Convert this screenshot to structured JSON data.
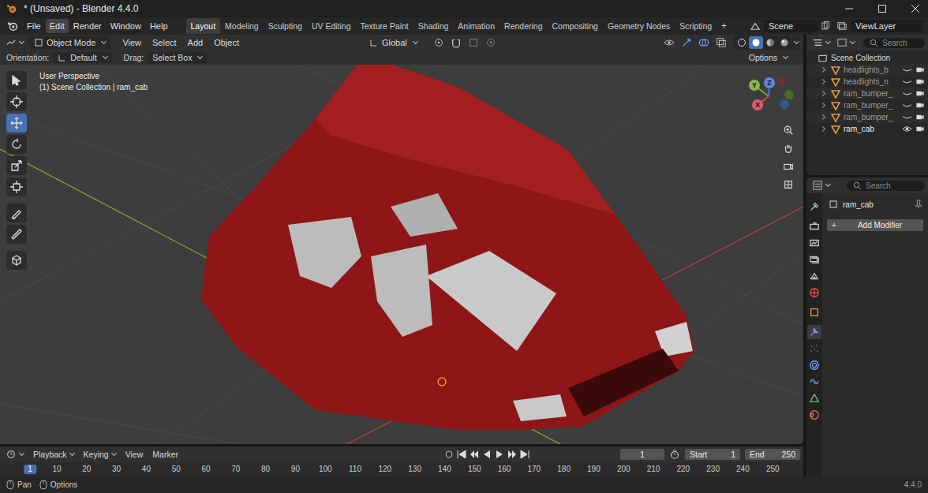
{
  "window": {
    "title": "* (Unsaved) - Blender 4.4.0"
  },
  "menu": [
    {
      "label": "File",
      "selected": false
    },
    {
      "label": "Edit",
      "selected": true
    },
    {
      "label": "Render",
      "selected": false
    },
    {
      "label": "Window",
      "selected": false
    },
    {
      "label": "Help",
      "selected": false
    }
  ],
  "workspaces": [
    {
      "label": "Layout",
      "selected": true
    },
    {
      "label": "Modeling",
      "selected": false
    },
    {
      "label": "Sculpting",
      "selected": false
    },
    {
      "label": "UV Editing",
      "selected": false
    },
    {
      "label": "Texture Paint",
      "selected": false
    },
    {
      "label": "Shading",
      "selected": false
    },
    {
      "label": "Animation",
      "selected": false
    },
    {
      "label": "Rendering",
      "selected": false
    },
    {
      "label": "Compositing",
      "selected": false
    },
    {
      "label": "Geometry Nodes",
      "selected": false
    },
    {
      "label": "Scripting",
      "selected": false
    }
  ],
  "workspace_add": "+",
  "scene": {
    "name": "Scene"
  },
  "view_layer": {
    "name": "ViewLayer"
  },
  "viewport_header": {
    "mode": "Object Mode",
    "menus": [
      "View",
      "Select",
      "Add",
      "Object"
    ],
    "orientation": "Global",
    "options": "Options",
    "shading_modes": [
      {
        "kind": "wireframe",
        "selected": false
      },
      {
        "kind": "solid",
        "selected": true
      },
      {
        "kind": "material",
        "selected": false
      },
      {
        "kind": "rendered",
        "selected": false
      }
    ]
  },
  "tool_settings": {
    "orientation_label": "Orientation:",
    "orientation": "Default",
    "drag_label": "Drag:",
    "drag": "Select Box"
  },
  "viewport": {
    "view_name": "User Perspective",
    "context": "(1) Scene Collection | ram_cab",
    "gizmo_axes": [
      "Y",
      "Z",
      "X"
    ]
  },
  "toolbar": [
    {
      "kind": "select",
      "selected": false
    },
    {
      "kind": "cursor",
      "selected": false
    },
    {
      "kind": "move",
      "selected": true
    },
    {
      "kind": "rotate",
      "selected": false
    },
    {
      "kind": "scale",
      "selected": false
    },
    {
      "kind": "transform",
      "selected": false
    },
    {
      "kind": "annotate",
      "selected": false
    },
    {
      "kind": "measure",
      "selected": false
    },
    {
      "kind": "add-cube",
      "selected": false
    }
  ],
  "outliner": {
    "search_placeholder": "Search",
    "root": "Scene Collection",
    "items": [
      {
        "name": "headlights_b",
        "visible": false,
        "selected": false
      },
      {
        "name": "headlights_n",
        "visible": false,
        "selected": false
      },
      {
        "name": "ram_bumper_",
        "visible": false,
        "selected": false
      },
      {
        "name": "ram_bumper_",
        "visible": false,
        "selected": false
      },
      {
        "name": "ram_bumper_",
        "visible": false,
        "selected": false
      },
      {
        "name": "ram_cab",
        "visible": true,
        "selected": true
      }
    ]
  },
  "properties": {
    "search_placeholder": "Search",
    "object": "ram_cab",
    "add_modifier": "Add Modifier",
    "add_icon": "+",
    "tabs": [
      {
        "kind": "tool",
        "selected": false
      },
      {
        "kind": "render",
        "selected": false
      },
      {
        "kind": "output",
        "selected": false
      },
      {
        "kind": "view-layer",
        "selected": false
      },
      {
        "kind": "scene",
        "selected": false
      },
      {
        "kind": "world",
        "selected": false
      },
      {
        "kind": "object",
        "selected": false
      },
      {
        "kind": "modifier",
        "selected": true
      },
      {
        "kind": "particles",
        "selected": false
      },
      {
        "kind": "physics",
        "selected": false
      },
      {
        "kind": "constraints",
        "selected": false
      },
      {
        "kind": "data",
        "selected": false
      },
      {
        "kind": "material",
        "selected": false
      }
    ]
  },
  "timeline": {
    "menus": [
      "Playback",
      "Keying",
      "View",
      "Marker"
    ],
    "current_frame": "1",
    "start_label": "Start",
    "start": "1",
    "end_label": "End",
    "end": "250",
    "ticks": [
      "1",
      "10",
      "20",
      "30",
      "40",
      "50",
      "60",
      "70",
      "80",
      "90",
      "100",
      "110",
      "120",
      "130",
      "140",
      "150",
      "160",
      "170",
      "180",
      "190",
      "200",
      "210",
      "220",
      "230",
      "240",
      "250"
    ]
  },
  "status_bar": {
    "hints": [
      "Pan",
      "Options"
    ],
    "version": "4.4.0"
  }
}
